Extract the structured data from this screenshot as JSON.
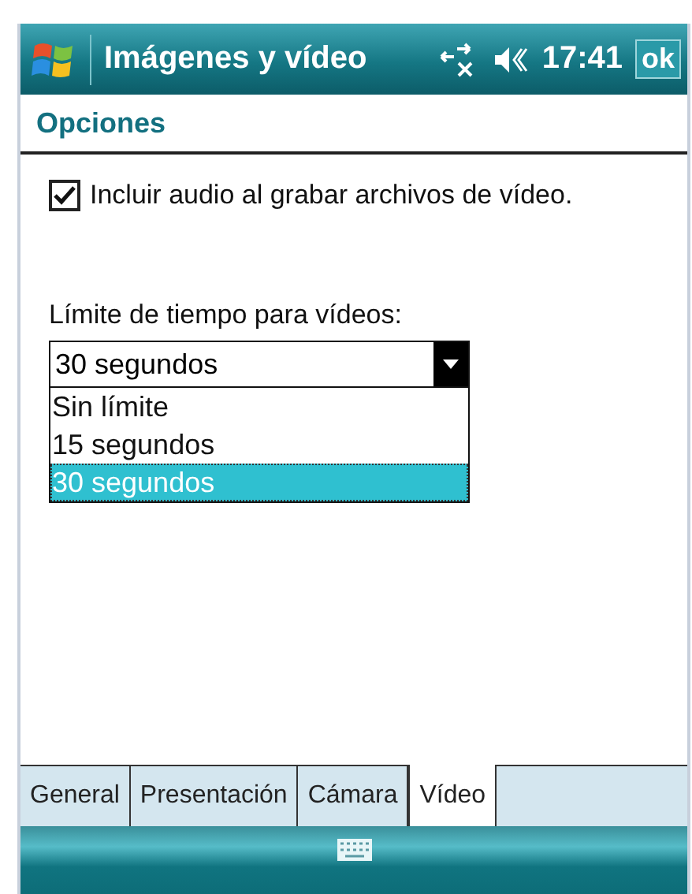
{
  "title_bar": {
    "title": "Imágenes y vídeo",
    "time": "17:41",
    "ok_button": "ok"
  },
  "header": "Opciones",
  "include_audio": {
    "label": "Incluir audio al grabar archivos de vídeo.",
    "checked": true
  },
  "time_limit": {
    "label": "Límite de tiempo para vídeos:",
    "value": "30 segundos",
    "expanded": true,
    "options": [
      {
        "label": "Sin límite",
        "selected": false
      },
      {
        "label": "15 segundos",
        "selected": false
      },
      {
        "label": "30 segundos",
        "selected": true
      }
    ]
  },
  "tabs": [
    {
      "label": "General",
      "selected": false
    },
    {
      "label": "Presentación",
      "selected": false
    },
    {
      "label": "Cámara",
      "selected": false
    },
    {
      "label": "Vídeo",
      "selected": true
    }
  ]
}
